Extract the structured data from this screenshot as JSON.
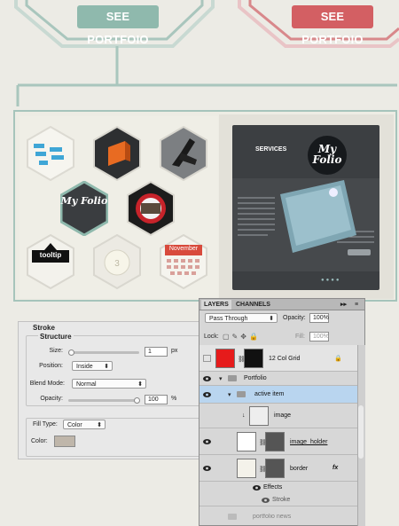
{
  "top": {
    "teal_button": "SEE PORTFOIO",
    "red_button": "SEE PORTFOIO",
    "colors": {
      "teal": "#8fb9ad",
      "red": "#d35f63",
      "frame": "#a6c4bb"
    }
  },
  "portfolio": {
    "hex_items": [
      {
        "name": "flowchart"
      },
      {
        "name": "orange-box"
      },
      {
        "name": "hand-pen"
      },
      {
        "name": "my-folio-logo",
        "text": "My Folio"
      },
      {
        "name": "monitor"
      },
      {
        "name": "tooltip",
        "text": "tooltip"
      },
      {
        "name": "css3-button"
      },
      {
        "name": "calendar",
        "text": "November"
      }
    ],
    "slide": {
      "services": "SERVICES",
      "logo": "My Folio",
      "dots": "●●●●"
    }
  },
  "stroke_panel": {
    "title": "Stroke",
    "structure": "Structure",
    "size_label": "Size:",
    "size_value": "1",
    "size_unit": "px",
    "position_label": "Position:",
    "position_value": "Inside",
    "blend_label": "Blend Mode:",
    "blend_value": "Normal",
    "opacity_label": "Opacity:",
    "opacity_value": "100",
    "opacity_unit": "%",
    "fill_type_label": "Fill Type:",
    "fill_type_value": "Color",
    "color_label": "Color:",
    "color_swatch": "#bfb6aa"
  },
  "layers_panel": {
    "tabs": [
      "LAYERS",
      "CHANNELS"
    ],
    "blend_mode": "Pass Through",
    "opacity_label": "Opacity:",
    "opacity_value": "100%",
    "lock_label": "Lock:",
    "fill_label": "Fill:",
    "fill_value": "100%",
    "layers": [
      {
        "name": "12 Col Grid"
      },
      {
        "name": "Portfolio"
      },
      {
        "name": "active item"
      },
      {
        "name": "image"
      },
      {
        "name": "image_holder"
      },
      {
        "name": "border"
      },
      {
        "name": "Effects"
      },
      {
        "name": "Stroke"
      },
      {
        "name": "portfolio news"
      }
    ],
    "fx_label": "fx"
  }
}
